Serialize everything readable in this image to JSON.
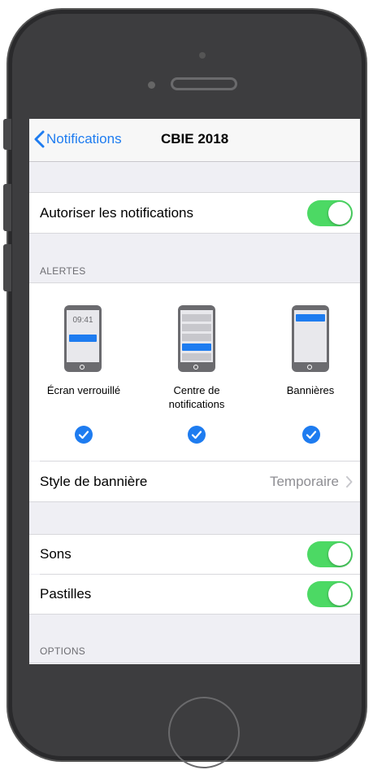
{
  "nav": {
    "back_label": "Notifications",
    "title": "CBIE 2018"
  },
  "allow": {
    "label": "Autoriser les notifications",
    "on": true
  },
  "alerts": {
    "header": "ALERTES",
    "lock_time": "09:41",
    "options": [
      {
        "label": "Écran verrouillé",
        "checked": true
      },
      {
        "label_line1": "Centre de",
        "label_line2": "notifications",
        "checked": true
      },
      {
        "label": "Bannières",
        "checked": true
      }
    ]
  },
  "banner_style": {
    "label": "Style de bannière",
    "value": "Temporaire"
  },
  "sounds": {
    "label": "Sons",
    "on": true
  },
  "badges": {
    "label": "Pastilles",
    "on": true
  },
  "options_header": "OPTIONS",
  "colors": {
    "accent": "#1e7cf0",
    "toggle_on": "#4cd964",
    "phone_body": "#3d3d3f"
  },
  "icons": [
    "chevron-left-icon",
    "checkmark-icon",
    "chevron-right-icon",
    "phone-lock-icon",
    "phone-notification-center-icon",
    "phone-banner-icon"
  ]
}
